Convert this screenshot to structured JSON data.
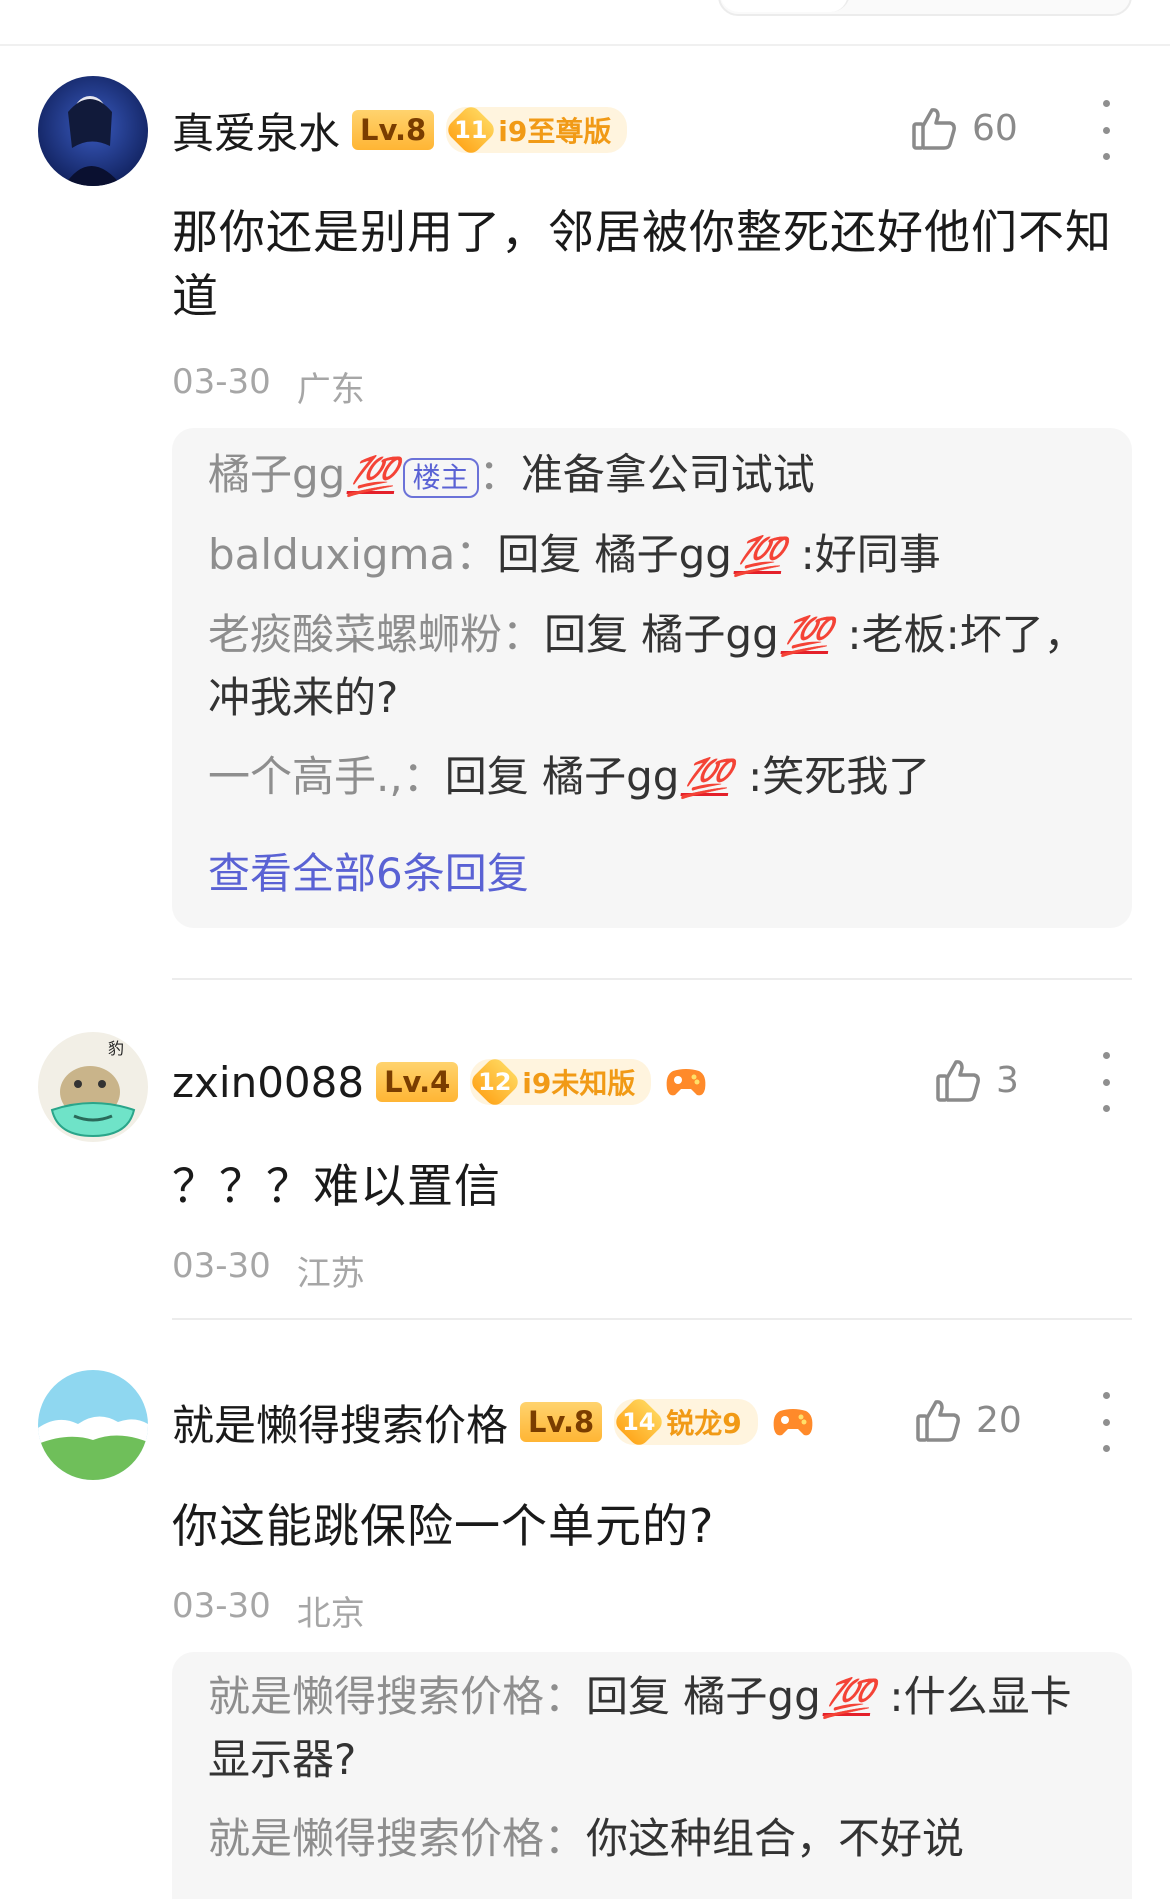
{
  "comments": [
    {
      "username": "真爱泉水",
      "level": "Lv.8",
      "device_num": "11",
      "device_label": "i9至尊版",
      "likes": "60",
      "text": "那你还是别用了，邻居被你整死还好他们不知道",
      "date": "03-30",
      "location": "广东",
      "avatar_colors": [
        "#0f1f5a",
        "#3a5bc0"
      ],
      "replies": [
        {
          "name": "橘子gg",
          "badge": "💯",
          "op_tag": "楼主",
          "text": "准备拿公司试试"
        },
        {
          "name": "balduxigma",
          "reply_prefix": "回复",
          "target": "橘子gg",
          "badge": "💯",
          "text": ":好同事"
        },
        {
          "name": "老痰酸菜螺蛳粉",
          "reply_prefix": "回复",
          "target": "橘子gg",
          "badge": "💯",
          "text": ":老板:坏了，冲我来的?"
        },
        {
          "name": "一个高手.,",
          "reply_prefix": "回复",
          "target": "橘子gg",
          "badge": "💯",
          "text": ":笑死我了"
        }
      ],
      "view_all": "查看全部6条回复"
    },
    {
      "username": "zxin0088",
      "level": "Lv.4",
      "device_num": "12",
      "device_label": "i9未知版",
      "likes": "3",
      "text": "？？？难以置信",
      "date": "03-30",
      "location": "江苏"
    },
    {
      "username": "就是懒得搜索价格",
      "level": "Lv.8",
      "device_num": "14",
      "device_label": "锐龙9",
      "likes": "20",
      "text": "你这能跳保险一个单元的?",
      "date": "03-30",
      "location": "北京",
      "replies": [
        {
          "name": "就是懒得搜索价格",
          "reply_prefix": "回复",
          "target": "橘子gg",
          "badge": "💯",
          "text": ":什么显卡显示器?"
        },
        {
          "name": "就是懒得搜索价格",
          "text": "你这种组合，不好说"
        }
      ]
    }
  ],
  "colors": {
    "accent": "#5a62d4",
    "level_badge": "#ffb534",
    "device_badge_text": "#f19a16",
    "hundred_badge": "#e4202a"
  }
}
